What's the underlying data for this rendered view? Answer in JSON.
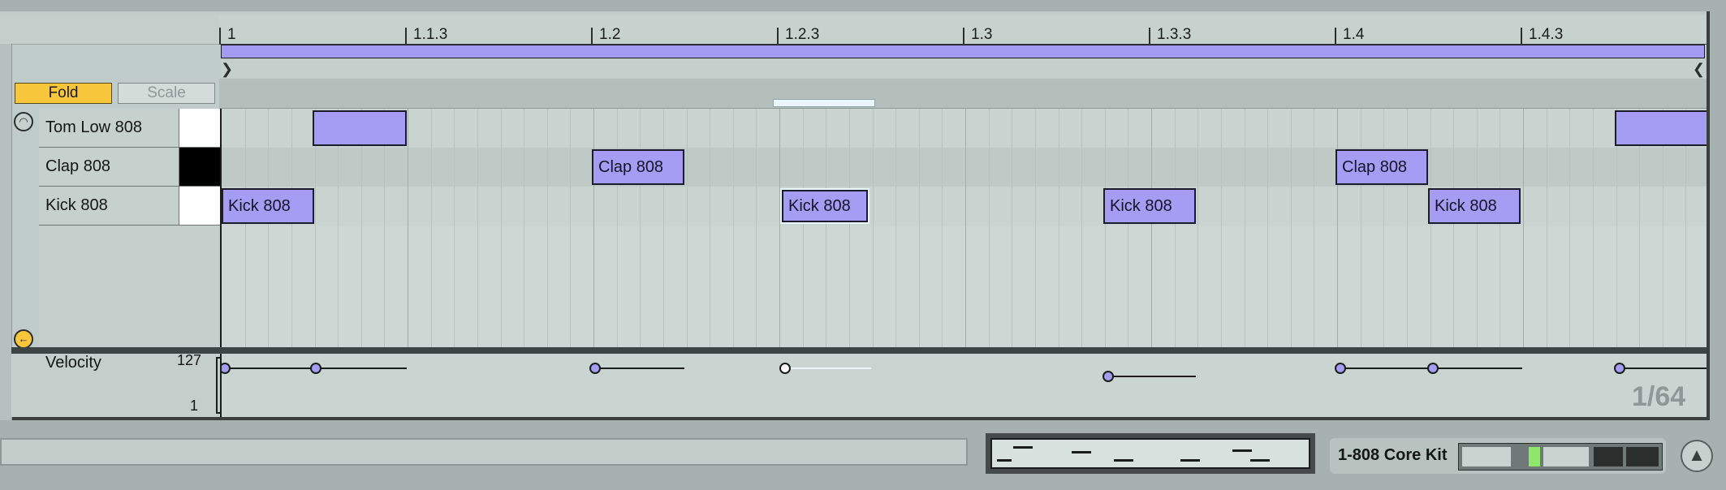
{
  "ruler": {
    "labels": [
      "1",
      "1.1.3",
      "1.2",
      "1.2.3",
      "1.3",
      "1.3.3",
      "1.4",
      "1.4.3"
    ]
  },
  "controls": {
    "fold_label": "Fold",
    "scale_label": "Scale"
  },
  "tracks": [
    {
      "name": "Tom Low 808",
      "swatch": "#ffffff"
    },
    {
      "name": "Clap 808",
      "swatch": "#000000"
    },
    {
      "name": "Kick 808",
      "swatch": "#ffffff"
    }
  ],
  "notes": {
    "tom_unlabeled_1": "",
    "tom_unlabeled_2": "",
    "clap_1": "Clap 808",
    "clap_2": "Clap 808",
    "kick_1": "Kick 808",
    "kick_2": "Kick 808",
    "kick_3": "Kick 808",
    "kick_4": "Kick 808"
  },
  "velocity": {
    "label": "Velocity",
    "max": "127",
    "min": "1"
  },
  "grid": {
    "resolution": "1/64"
  },
  "device": {
    "name": "1-808 Core Kit"
  },
  "colors": {
    "note_fill": "#a59cf4",
    "fold_active": "#f7c63a",
    "editor_bg": "#c0ccc9"
  }
}
